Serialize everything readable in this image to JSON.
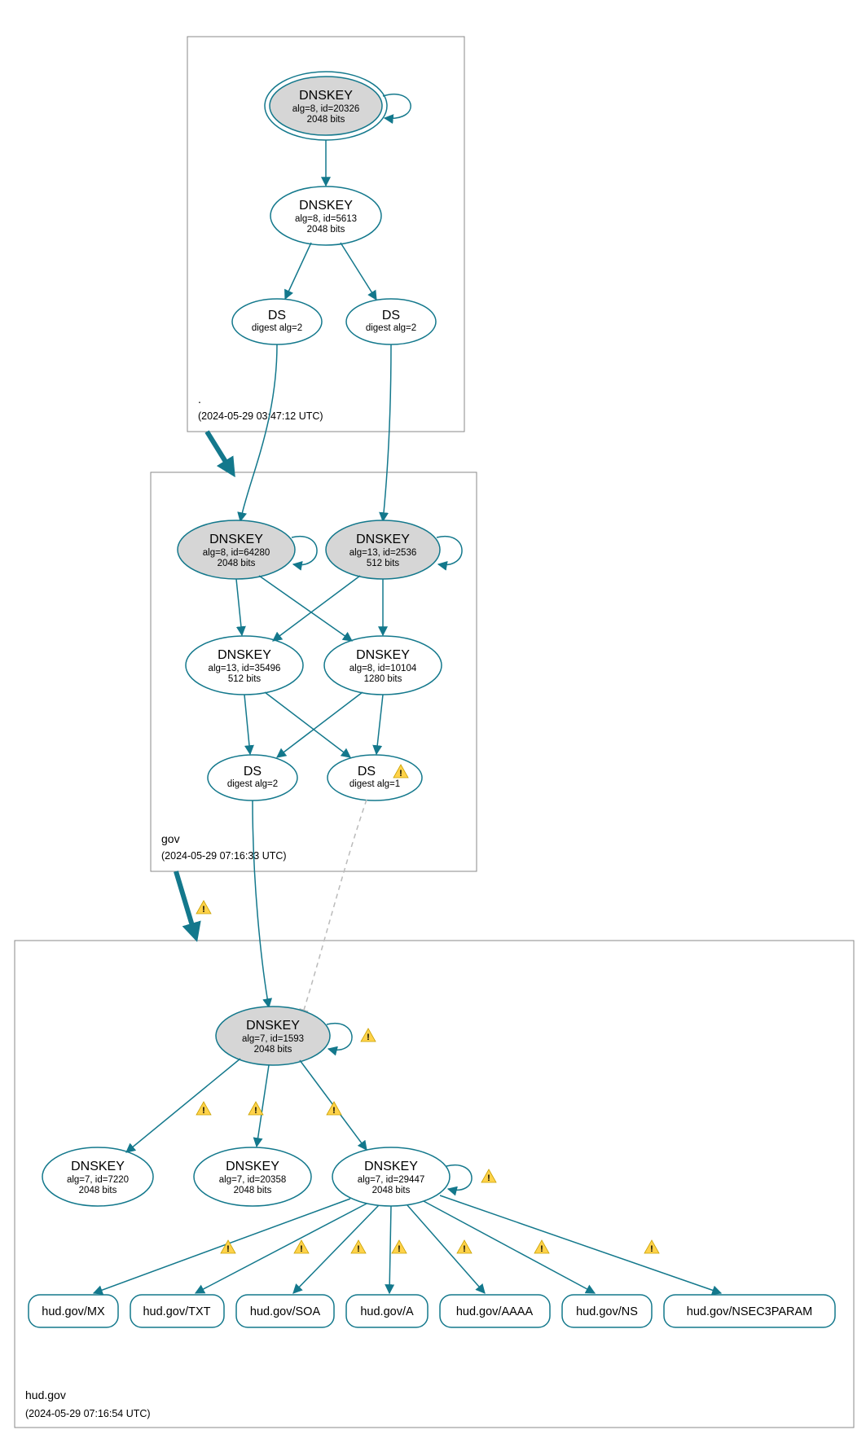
{
  "colors": {
    "stroke": "#13788c",
    "ksk_fill": "#d6d6d6"
  },
  "zones": {
    "root": {
      "label": ".",
      "timestamp": "(2024-05-29 03:47:12 UTC)"
    },
    "gov": {
      "label": "gov",
      "timestamp": "(2024-05-29 07:16:33 UTC)"
    },
    "hud": {
      "label": "hud.gov",
      "timestamp": "(2024-05-29 07:16:54 UTC)"
    }
  },
  "nodes": {
    "root_ksk": {
      "title": "DNSKEY",
      "line1": "alg=8, id=20326",
      "line2": "2048 bits"
    },
    "root_zsk": {
      "title": "DNSKEY",
      "line1": "alg=8, id=5613",
      "line2": "2048 bits"
    },
    "root_ds1": {
      "title": "DS",
      "line1": "digest alg=2"
    },
    "root_ds2": {
      "title": "DS",
      "line1": "digest alg=2"
    },
    "gov_ksk1": {
      "title": "DNSKEY",
      "line1": "alg=8, id=64280",
      "line2": "2048 bits"
    },
    "gov_ksk2": {
      "title": "DNSKEY",
      "line1": "alg=13, id=2536",
      "line2": "512 bits"
    },
    "gov_zsk1": {
      "title": "DNSKEY",
      "line1": "alg=13, id=35496",
      "line2": "512 bits"
    },
    "gov_zsk2": {
      "title": "DNSKEY",
      "line1": "alg=8, id=10104",
      "line2": "1280 bits"
    },
    "gov_ds1": {
      "title": "DS",
      "line1": "digest alg=2"
    },
    "gov_ds2": {
      "title": "DS",
      "line1": "digest alg=1"
    },
    "hud_ksk": {
      "title": "DNSKEY",
      "line1": "alg=7, id=1593",
      "line2": "2048 bits"
    },
    "hud_k1": {
      "title": "DNSKEY",
      "line1": "alg=7, id=7220",
      "line2": "2048 bits"
    },
    "hud_k2": {
      "title": "DNSKEY",
      "line1": "alg=7, id=20358",
      "line2": "2048 bits"
    },
    "hud_k3": {
      "title": "DNSKEY",
      "line1": "alg=7, id=29447",
      "line2": "2048 bits"
    },
    "rr_mx": {
      "label": "hud.gov/MX"
    },
    "rr_txt": {
      "label": "hud.gov/TXT"
    },
    "rr_soa": {
      "label": "hud.gov/SOA"
    },
    "rr_a": {
      "label": "hud.gov/A"
    },
    "rr_aaaa": {
      "label": "hud.gov/AAAA"
    },
    "rr_ns": {
      "label": "hud.gov/NS"
    },
    "rr_nsec3": {
      "label": "hud.gov/NSEC3PARAM"
    }
  }
}
